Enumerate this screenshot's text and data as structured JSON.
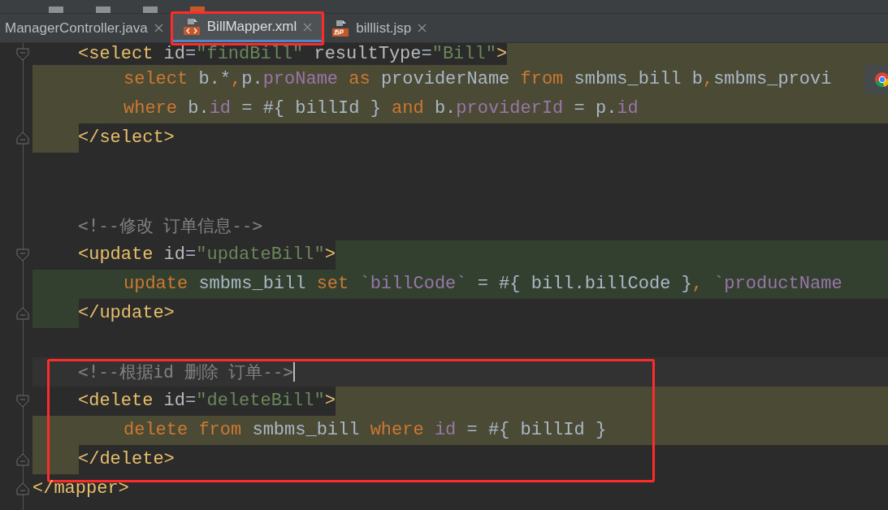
{
  "tabs": [
    {
      "label": "ManagerController.java",
      "kind": "plain",
      "selected": false,
      "circled": false
    },
    {
      "label": "BillMapper.xml",
      "kind": "xml",
      "selected": true,
      "circled": true
    },
    {
      "label": "billlist.jsp",
      "kind": "jsp",
      "selected": false,
      "circled": false
    }
  ],
  "mapper": {
    "children": [
      {
        "kind": "element",
        "color": "#4b4a35",
        "circled": false,
        "open": [
          {
            "kind": "tag",
            "text": "<select"
          },
          {
            "kind": "attr",
            "text": " id"
          },
          {
            "kind": "plain",
            "text": "="
          },
          {
            "kind": "string",
            "text": "\"findBill\""
          },
          {
            "kind": "attr",
            "text": " resultType"
          },
          {
            "kind": "plain",
            "text": "="
          },
          {
            "kind": "string",
            "text": "\"Bill\""
          },
          {
            "kind": "tag",
            "text": ">"
          }
        ],
        "children": [
          {
            "tokens": [
              {
                "kind": "keyword",
                "text": "select"
              },
              {
                "kind": "plain",
                "text": " b.*"
              },
              {
                "kind": "keyword",
                "text": ","
              },
              {
                "kind": "plain",
                "text": "p."
              },
              {
                "kind": "field",
                "text": "proName"
              },
              {
                "kind": "keyword",
                "text": " as "
              },
              {
                "kind": "plain",
                "text": "providerName "
              },
              {
                "kind": "keyword",
                "text": "from"
              },
              {
                "kind": "plain",
                "text": " smbms_bill b"
              },
              {
                "kind": "keyword",
                "text": ","
              },
              {
                "kind": "plain",
                "text": "smbms_provi"
              }
            ]
          },
          {
            "tokens": [
              {
                "kind": "keyword",
                "text": "where"
              },
              {
                "kind": "plain",
                "text": " b."
              },
              {
                "kind": "field",
                "text": "id"
              },
              {
                "kind": "plain",
                "text": " = #{ billId } "
              },
              {
                "kind": "keyword",
                "text": "and"
              },
              {
                "kind": "plain",
                "text": " b."
              },
              {
                "kind": "field",
                "text": "providerId"
              },
              {
                "kind": "plain",
                "text": " = p."
              },
              {
                "kind": "field",
                "text": "id"
              }
            ]
          }
        ],
        "close": "</select>"
      },
      {
        "kind": "blank"
      },
      {
        "kind": "blank"
      },
      {
        "kind": "comment",
        "text": "<!--修改 订单信息-->",
        "current": false,
        "circled": false
      },
      {
        "kind": "element",
        "color": "#33402f",
        "circled": false,
        "open": [
          {
            "kind": "tag",
            "text": "<update"
          },
          {
            "kind": "attr",
            "text": " id"
          },
          {
            "kind": "plain",
            "text": "="
          },
          {
            "kind": "string",
            "text": "\"updateBill\""
          },
          {
            "kind": "tag",
            "text": ">"
          }
        ],
        "children": [
          {
            "tokens": [
              {
                "kind": "keyword",
                "text": "update"
              },
              {
                "kind": "plain",
                "text": " smbms_bill "
              },
              {
                "kind": "keyword",
                "text": "set"
              },
              {
                "kind": "field",
                "text": " `billCode`"
              },
              {
                "kind": "plain",
                "text": " = #{ bill.billCode }"
              },
              {
                "kind": "keyword",
                "text": ","
              },
              {
                "kind": "field",
                "text": " `productName"
              }
            ]
          }
        ],
        "close": "</update>"
      },
      {
        "kind": "blank"
      },
      {
        "kind": "comment",
        "text": "<!--根据id 删除 订单-->",
        "current": true,
        "circled": true
      },
      {
        "kind": "element",
        "color": "#4b4a35",
        "circled": true,
        "open": [
          {
            "kind": "tag",
            "text": "<delete"
          },
          {
            "kind": "attr",
            "text": " id"
          },
          {
            "kind": "plain",
            "text": "="
          },
          {
            "kind": "string",
            "text": "\"deleteBill\""
          },
          {
            "kind": "tag",
            "text": ">"
          }
        ],
        "children": [
          {
            "tokens": [
              {
                "kind": "keyword",
                "text": "delete from"
              },
              {
                "kind": "plain",
                "text": " smbms_bill "
              },
              {
                "kind": "keyword",
                "text": "where"
              },
              {
                "kind": "field",
                "text": " id"
              },
              {
                "kind": "plain",
                "text": " = #{ billId }"
              }
            ]
          }
        ],
        "close": "</delete>"
      }
    ],
    "close": "</mapper>"
  }
}
